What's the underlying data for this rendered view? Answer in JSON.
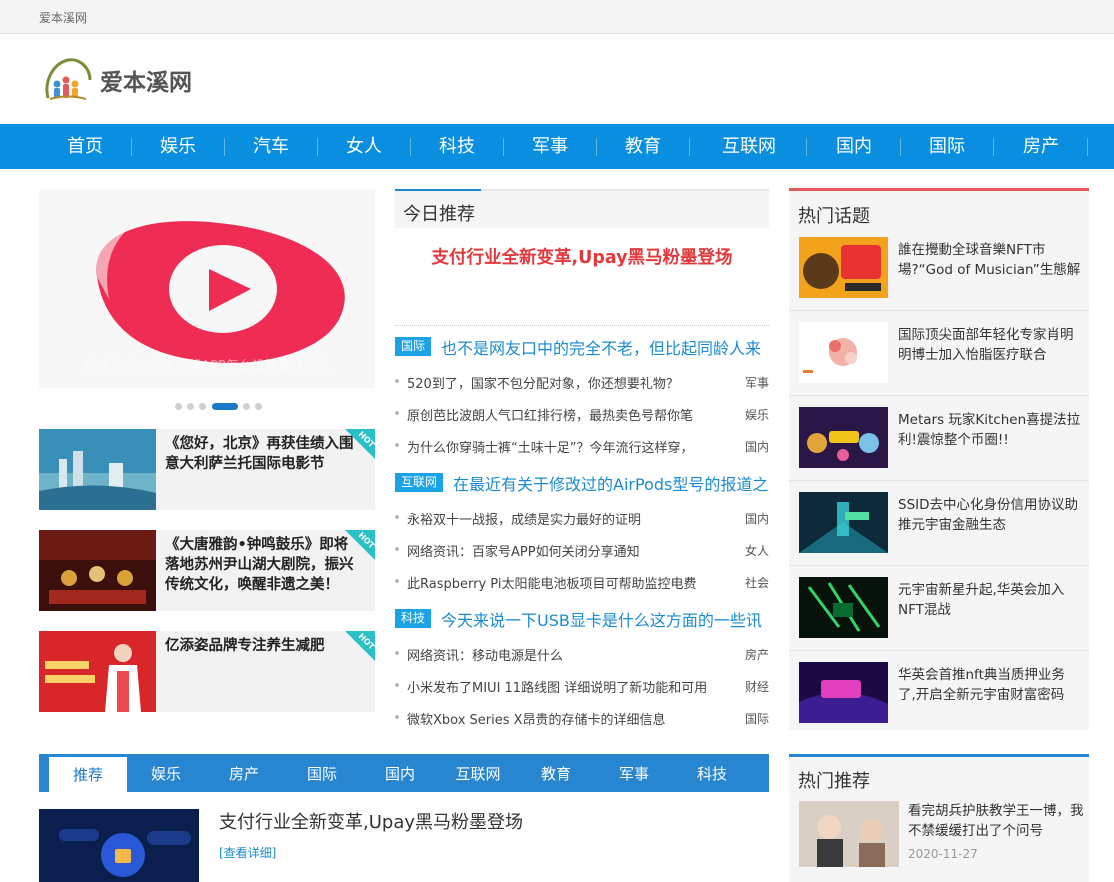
{
  "topbar": {
    "site_name": "爱本溪网"
  },
  "logo": {
    "text": "爱本溪网"
  },
  "nav": {
    "items": [
      "首页",
      "娱乐",
      "汽车",
      "女人",
      "科技",
      "军事",
      "教育",
      "互联网",
      "国内",
      "国际",
      "房产"
    ]
  },
  "banner": {
    "caption": "网络资讯：西瓜视频APP怎么设置推送消息"
  },
  "featured": [
    {
      "title": "《您好，北京》再获佳绩入围意大利萨兰托国际电影节",
      "badge": "HOT"
    },
    {
      "title": "《大唐雅韵•钟鸣鼓乐》即将落地苏州尹山湖大剧院，振兴传统文化，唤醒非遗之美！",
      "badge": "HOT"
    },
    {
      "title": "亿添姿品牌专注养生减肥",
      "badge": "HOT"
    }
  ],
  "today": {
    "heading": "今日推荐",
    "headline": "支付行业全新变革,Upay黑马粉墨登场",
    "groups": [
      {
        "tag": "国际",
        "title": "也不是网友口中的完全不老，但比起同龄人来",
        "items": [
          {
            "title": "520到了，国家不包分配对象，你还想要礼物？",
            "category": "军事"
          },
          {
            "title": "原创芭比波朗人气口红排行榜，最热卖色号帮你笔",
            "category": "娱乐"
          },
          {
            "title": "为什么你穿骑士裤“土味十足”？今年流行这样穿，",
            "category": "国内"
          }
        ]
      },
      {
        "tag": "互联网",
        "title": "在最近有关于修改过的AirPods型号的报道之",
        "items": [
          {
            "title": "永裕双十一战报，成绩是实力最好的证明",
            "category": "国内"
          },
          {
            "title": "网络资讯：百家号APP如何关闭分享通知",
            "category": "女人"
          },
          {
            "title": "此Raspberry Pi太阳能电池板项目可帮助监控电费",
            "category": "社会"
          }
        ]
      },
      {
        "tag": "科技",
        "title": "今天来说一下USB显卡是什么这方面的一些讯",
        "items": [
          {
            "title": "网络资讯：移动电源是什么",
            "category": "房产"
          },
          {
            "title": "小米发布了MIUI 11路线图 详细说明了新功能和可用",
            "category": "财经"
          },
          {
            "title": "微软Xbox Series X昂贵的存储卡的详细信息",
            "category": "国际"
          }
        ]
      }
    ]
  },
  "hot_topics": {
    "heading": "热门话题",
    "items": [
      {
        "title": "誰在攪動全球音樂NFT市場?“God of Musician”生態解"
      },
      {
        "title": "国际顶尖面部年轻化专家肖明明博士加入怡脂医疗联合"
      },
      {
        "title": "Metars 玩家Kitchen喜提法拉利!震惊整个币圈!!"
      },
      {
        "title": "SSID去中心化身份信用协议助推元宇宙金融生态"
      },
      {
        "title": "元宇宙新星升起,华英会加入NFT混战"
      },
      {
        "title": "华英会首推nft典当质押业务了,开启全新元宇宙财富密码"
      }
    ]
  },
  "tabs": {
    "items": [
      "推荐",
      "娱乐",
      "房产",
      "国际",
      "国内",
      "互联网",
      "教育",
      "军事",
      "科技"
    ],
    "active": "推荐"
  },
  "bottom_article": {
    "title": "支付行业全新变革,Upay黑马粉墨登场",
    "link": "[查看详细]"
  },
  "hot_recommend": {
    "heading": "热门推荐",
    "item": {
      "title": "看完胡兵护肤教学王一博，我不禁缓缓打出了个问号",
      "date": "2020-11-27"
    }
  },
  "colors": {
    "nav": "#0a8fe0",
    "accent_red": "#e3393c",
    "link_blue": "#1a8bd1",
    "tag_blue": "#1ca3e6",
    "hot_red": "#e25b5b",
    "tab_blue": "#2886d0"
  }
}
